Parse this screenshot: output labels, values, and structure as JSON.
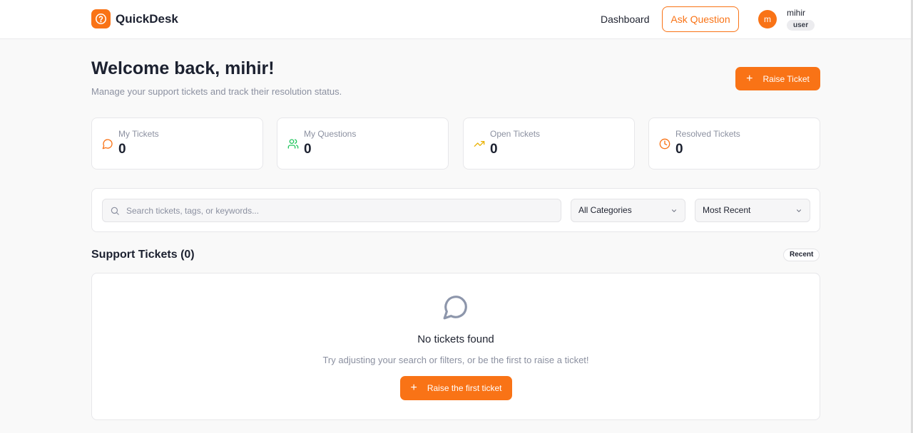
{
  "brand": {
    "name": "QuickDesk",
    "accent": "#f97316"
  },
  "nav": {
    "dashboard": "Dashboard",
    "ask_question": "Ask Question"
  },
  "user": {
    "initial": "m",
    "name": "mihir",
    "role": "user"
  },
  "welcome": {
    "title": "Welcome back, mihir!",
    "subtitle": "Manage your support tickets and track their resolution status.",
    "raise_ticket": "Raise Ticket"
  },
  "stats": [
    {
      "label": "My Tickets",
      "value": "0",
      "icon": "chat-icon",
      "color": "#f97316"
    },
    {
      "label": "My Questions",
      "value": "0",
      "icon": "users-icon",
      "color": "#22c55e"
    },
    {
      "label": "Open Tickets",
      "value": "0",
      "icon": "trending-up-icon",
      "color": "#eab308"
    },
    {
      "label": "Resolved Tickets",
      "value": "0",
      "icon": "clock-icon",
      "color": "#f97316"
    }
  ],
  "filters": {
    "search_placeholder": "Search tickets, tags, or keywords...",
    "search_value": "",
    "category": "All Categories",
    "sort": "Most Recent"
  },
  "tickets": {
    "title": "Support Tickets (0)",
    "badge": "Recent",
    "empty_title": "No tickets found",
    "empty_subtitle": "Try adjusting your search or filters, or be the first to raise a ticket!",
    "empty_button": "Raise the first ticket"
  }
}
